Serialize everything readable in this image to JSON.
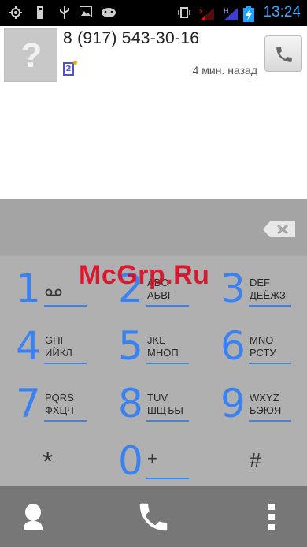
{
  "status_bar": {
    "time": "13:24",
    "icons": [
      "gps-icon",
      "sd-card-icon",
      "usb-icon",
      "image-icon",
      "android-icon",
      "vibrate-icon",
      "signal-icon",
      "signal-icon",
      "battery-charging-icon"
    ]
  },
  "call_log": {
    "number": "8 (917) 543-30-16",
    "sim_label": "2",
    "time_ago": "4 мин. назад"
  },
  "keypad": {
    "keys": [
      {
        "digit": "1",
        "line1": "",
        "line2": ""
      },
      {
        "digit": "2",
        "line1": "ABC",
        "line2": "АБВГ"
      },
      {
        "digit": "3",
        "line1": "DEF",
        "line2": "ДЕЁЖЗ"
      },
      {
        "digit": "4",
        "line1": "GHI",
        "line2": "ИЙКЛ"
      },
      {
        "digit": "5",
        "line1": "JKL",
        "line2": "МНОП"
      },
      {
        "digit": "6",
        "line1": "MNO",
        "line2": "РСТУ"
      },
      {
        "digit": "7",
        "line1": "PQRS",
        "line2": "ФХЦЧ"
      },
      {
        "digit": "8",
        "line1": "TUV",
        "line2": "ШЩЪЫ"
      },
      {
        "digit": "9",
        "line1": "WXYZ",
        "line2": "ЬЭЮЯ"
      }
    ],
    "star": "*",
    "zero": "0",
    "plus": "+",
    "hash": "#"
  },
  "watermark": "McGrp.Ru",
  "colors": {
    "accent": "#3b82f0",
    "keypad_bg": "#b0b0b0",
    "watermark": "#e0001a"
  }
}
